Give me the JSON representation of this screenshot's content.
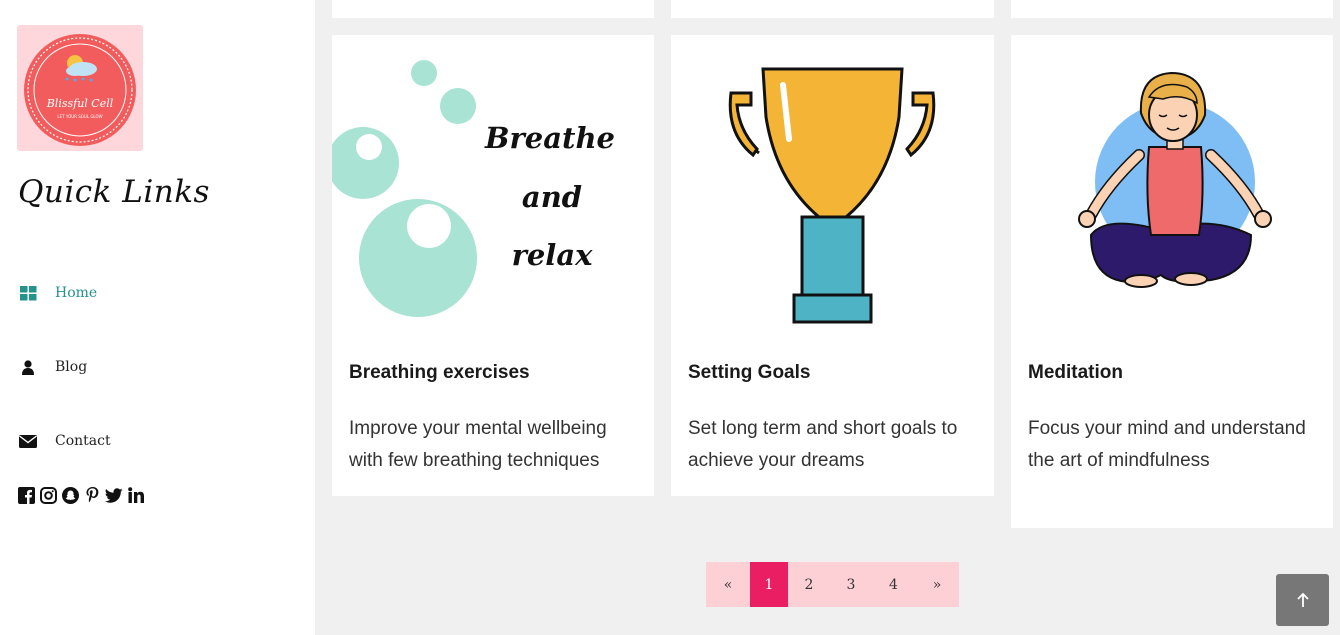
{
  "sidebar": {
    "logo_text": "Blissful Cell",
    "logo_tagline": "LET YOUR SOUL GLOW",
    "title": "Quick Links",
    "nav": [
      {
        "label": "Home",
        "icon": "grid-icon",
        "active": true
      },
      {
        "label": "Blog",
        "icon": "user-icon",
        "active": false
      },
      {
        "label": "Contact",
        "icon": "envelope-icon",
        "active": false
      }
    ],
    "social": [
      "facebook-icon",
      "instagram-icon",
      "snapchat-icon",
      "pinterest-icon",
      "twitter-icon",
      "linkedin-icon"
    ]
  },
  "cards": [
    {
      "image_text": [
        "Breathe",
        "and",
        "relax"
      ],
      "title": "Breathing exercises",
      "description": "Improve your mental wellbeing with few breathing techniques"
    },
    {
      "title": "Setting Goals",
      "description": "Set long term and short goals to achieve your dreams"
    },
    {
      "title": "Meditation",
      "description": "Focus your mind and understand the art of mindfulness"
    }
  ],
  "pagination": {
    "prev": "«",
    "pages": [
      "1",
      "2",
      "3",
      "4"
    ],
    "current": "1",
    "next": "»"
  },
  "colors": {
    "accent": "#e91e63",
    "pager_bg": "#fdd0d6",
    "active_nav": "#24928d",
    "logo_bg": "#fdd7db"
  }
}
